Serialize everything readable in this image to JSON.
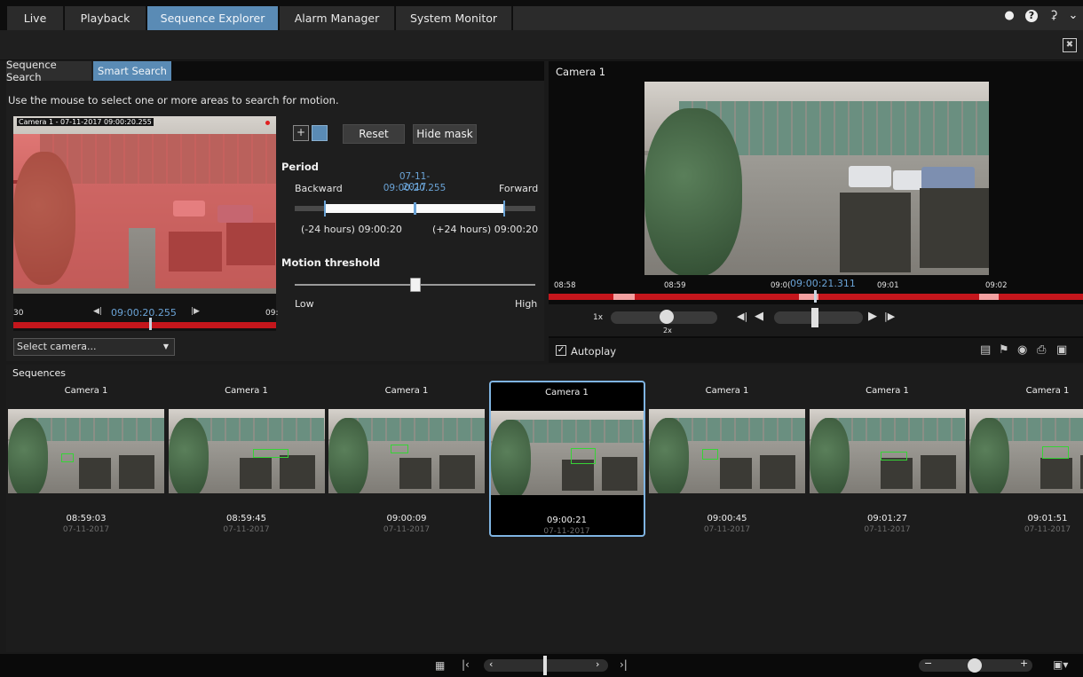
{
  "nav": {
    "tabs": [
      {
        "label": "Live"
      },
      {
        "label": "Playback"
      },
      {
        "label": "Sequence Explorer"
      },
      {
        "label": "Alarm Manager"
      },
      {
        "label": "System Monitor"
      }
    ],
    "active_tab": "Sequence Explorer",
    "accent_color": "#5a8bb5"
  },
  "top_icons": [
    "network-icon",
    "help-icon",
    "key-icon",
    "chevron-down-icon"
  ],
  "search_panel": {
    "tabs": [
      {
        "label": "Sequence Search"
      },
      {
        "label": "Smart Search"
      }
    ],
    "active_tab": "Smart Search",
    "instruction": "Use the mouse to select one or more areas to search for motion.",
    "preview_caption": "Camera 1 - 07-11-2017 09:00:20.255",
    "timeline_left_label": "30",
    "timeline_time": "09:00:20.255",
    "timeline_right_label": "09:",
    "select_camera": "Select camera...",
    "reset_label": "Reset",
    "hide_mask_label": "Hide mask",
    "period": {
      "heading": "Period",
      "backward": "Backward",
      "forward": "Forward",
      "center_date": "07-11-2017",
      "center_time": "09:00:20.255",
      "left_range": "(-24 hours) 09:00:20",
      "right_range": "(+24 hours) 09:00:20"
    },
    "motion_threshold": {
      "heading": "Motion threshold",
      "low": "Low",
      "high": "High",
      "level": 0.5
    }
  },
  "viewer": {
    "title": "Camera 1",
    "timeline_labels": [
      "08:58",
      "08:59",
      "09:0(",
      "09:00:21.311",
      "09:01",
      "09:02"
    ],
    "speed_left": "1x",
    "speed_center": "2x",
    "autoplay_label": "Autoplay",
    "autoplay_checked": true
  },
  "sequences": {
    "heading": "Sequences",
    "items": [
      {
        "camera": "Camera 1",
        "time": "08:59:03",
        "date": "07-11-2017",
        "selected": false
      },
      {
        "camera": "Camera 1",
        "time": "08:59:45",
        "date": "07-11-2017",
        "selected": false
      },
      {
        "camera": "Camera 1",
        "time": "09:00:09",
        "date": "07-11-2017",
        "selected": false
      },
      {
        "camera": "Camera 1",
        "time": "09:00:21",
        "date": "07-11-2017",
        "selected": true
      },
      {
        "camera": "Camera 1",
        "time": "09:00:45",
        "date": "07-11-2017",
        "selected": false
      },
      {
        "camera": "Camera 1",
        "time": "09:01:27",
        "date": "07-11-2017",
        "selected": false
      },
      {
        "camera": "Camera 1",
        "time": "09:01:51",
        "date": "07-11-2017",
        "selected": false
      }
    ]
  },
  "colors": {
    "timeline_red": "#c4161c",
    "motion_mask": "#eb4646",
    "detection_box": "#36d336",
    "selection_border": "#7fb4e2"
  }
}
